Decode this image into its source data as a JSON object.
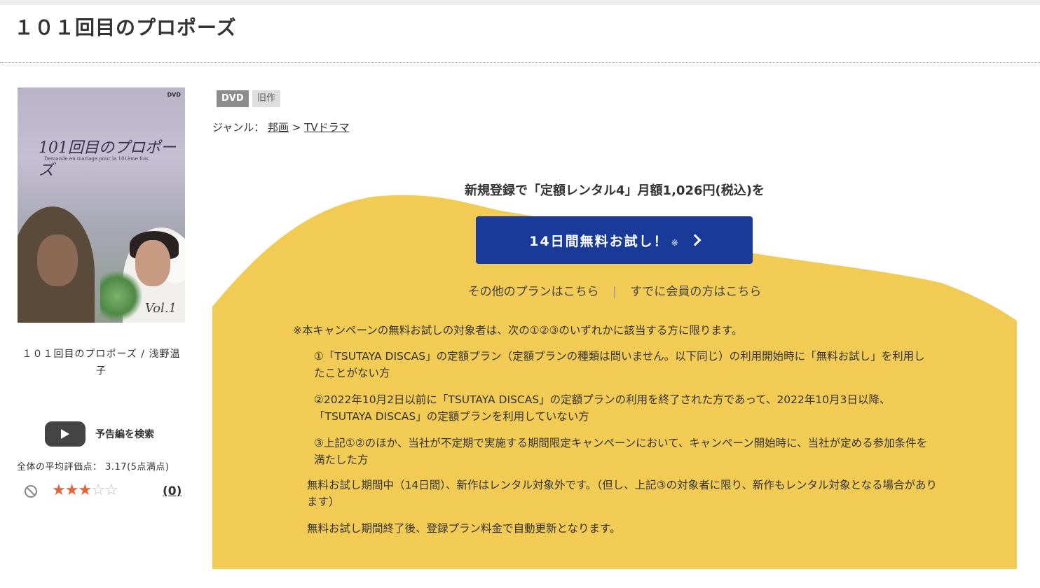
{
  "page": {
    "title": "１０１回目のプロポーズ"
  },
  "item": {
    "caption": "１０１回目のプロポーズ / 浅野温子",
    "cover": {
      "title": "101回目のプロポーズ",
      "subtitle": "Demande en mariage pour la 101ème fois",
      "vol": "Vol.1",
      "logo": "DVD"
    },
    "badges": [
      "DVD",
      "旧作"
    ],
    "genre": {
      "label": "ジャンル：",
      "items": [
        "邦画",
        "TVドラマ"
      ],
      "separator": ">"
    }
  },
  "trailer": {
    "label": "予告編を検索",
    "icon": "play-icon"
  },
  "rating": {
    "text": "全体の平均評価点： 3.17(5点満点)",
    "score": 3.17,
    "max": 5,
    "stars_filled": 3,
    "review_count": "(0)",
    "ban_icon": "prohibited-icon"
  },
  "promo": {
    "heading": "新規登録で「定額レンタル4」月額1,026円(税込)を",
    "cta": {
      "label": "14日間無料お試し！",
      "note": "※",
      "icon": "chevron-right-icon"
    },
    "links": {
      "other_plans": "その他のプランはこちら",
      "separator": "|",
      "member": "すでに会員の方はこちら"
    },
    "notice": "※本キャンペーンの無料お試しの対象者は、次の①②③のいずれかに該当する方に限ります。",
    "conditions": [
      "①「TSUTAYA DISCAS」の定額プラン（定額プランの種類は問いません。以下同じ）の利用開始時に「無料お試し」を利用したことがない方",
      "②2022年10月2日以前に「TSUTAYA DISCAS」の定額プランの利用を終了された方であって、2022年10月3日以降、「TSUTAYA DISCAS」の定額プランを利用していない方",
      "③上記①②のほか、当社が不定期で実施する期間限定キャンペーンにおいて、キャンペーン開始時に、当社が定める参加条件を満たした方"
    ],
    "paragraphs": [
      "無料お試し期間中（14日間）、新作はレンタル対象外です。（但し、上記③の対象者に限り、新作もレンタル対象となる場合があります）",
      "無料お試し期間終了後、登録プラン料金で自動更新となります。"
    ]
  },
  "colors": {
    "panel": "#f2cb55",
    "cta": "#1a3a9a",
    "star": "#e0653a"
  }
}
